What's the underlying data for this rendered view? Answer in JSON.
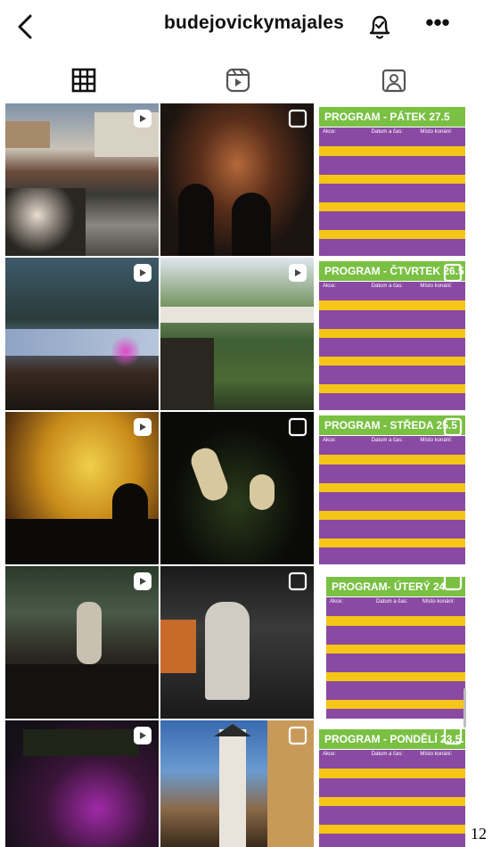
{
  "header": {
    "username": "budejovickymajales",
    "back_icon": "chevron-left-icon",
    "notify_icon": "bell-check-icon",
    "more_icon": "more-horizontal-icon",
    "more_glyph": "•••"
  },
  "tabs": [
    {
      "icon": "grid-icon",
      "active": true
    },
    {
      "icon": "reels-icon",
      "active": false
    },
    {
      "icon": "tagged-icon",
      "active": false
    }
  ],
  "posts": {
    "row1": [
      {
        "kind": "photo",
        "subject": "outdoor audience seated in courtyard",
        "overlay": "reel-icon"
      },
      {
        "kind": "photo",
        "subject": "evening crowd under string lights",
        "overlay": "multiple-icon"
      },
      {
        "kind": "poster",
        "title": "PROGRAM - PÁTEK 27.5",
        "title_bg": "#7ac043",
        "overlay": "none"
      }
    ],
    "row2": [
      {
        "kind": "photo",
        "subject": "festival tents at dusk with lights",
        "overlay": "reel-icon"
      },
      {
        "kind": "photo",
        "subject": "garden with tents and crowd",
        "overlay": "reel-icon"
      },
      {
        "kind": "poster",
        "title": "PROGRAM - ČTVRTEK 26.5",
        "title_bg": "#7ac043",
        "overlay": "multiple-icon"
      }
    ],
    "row3": [
      {
        "kind": "photo",
        "subject": "crowd under glowing tent canopy",
        "overlay": "reel-icon"
      },
      {
        "kind": "photo",
        "subject": "dancers on dark stage",
        "overlay": "multiple-icon"
      },
      {
        "kind": "poster",
        "title": "PROGRAM - STŘEDA 25.5",
        "title_bg": "#7ac043",
        "overlay": "multiple-icon"
      }
    ],
    "row4": [
      {
        "kind": "photo",
        "subject": "band playing outdoor concert",
        "overlay": "reel-icon"
      },
      {
        "kind": "photo",
        "subject": "singer performing on stage",
        "overlay": "multiple-icon"
      },
      {
        "kind": "poster",
        "title": "PROGRAM- ÚTERÝ 24.",
        "title_bg": "#7ac043",
        "overlay": "multiple-icon"
      }
    ],
    "row5": [
      {
        "kind": "photo",
        "subject": "night stage with purple lights",
        "overlay": "reel-icon"
      },
      {
        "kind": "photo",
        "subject": "white clock tower at night",
        "overlay": "multiple-icon"
      },
      {
        "kind": "poster",
        "title": "PROGRAM - PONDĚLÍ 23.5.",
        "title_bg": "#7ac043",
        "overlay": "multiple-icon"
      }
    ]
  },
  "poster_columns": [
    "Akce:",
    "Datum a čas:",
    "Místo konání:"
  ],
  "poster_row_colors": [
    "#8a4aa3",
    "#f5c518",
    "#8a4aa3",
    "#8a4aa3",
    "#f5c518",
    "#8a4aa3",
    "#8a4aa3",
    "#f5c518",
    "#8a4aa3",
    "#8a4aa3",
    "#f5c518",
    "#8a4aa3",
    "#8a4aa3"
  ],
  "page_number": "12",
  "colors": {
    "poster_green": "#7ac043",
    "poster_purple": "#8a4aa3",
    "poster_yellow": "#f5c518"
  }
}
